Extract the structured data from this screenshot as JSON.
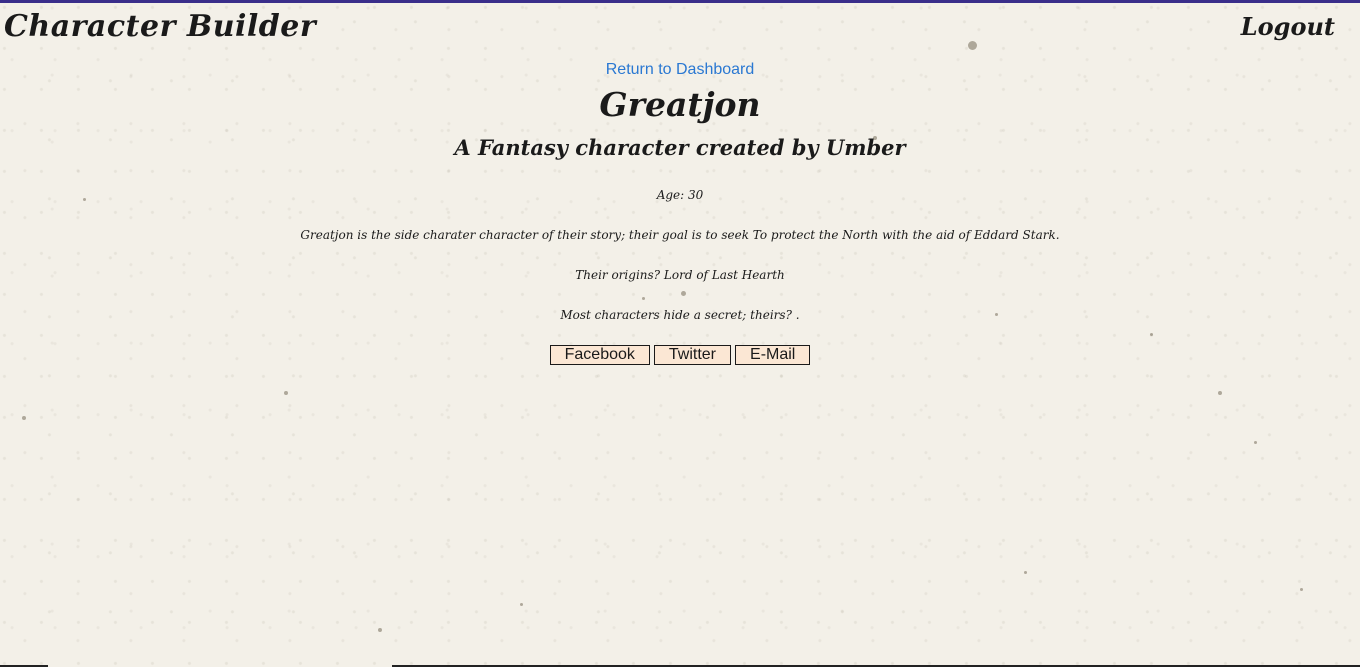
{
  "header": {
    "brand": "Character Builder",
    "logout_label": "Logout"
  },
  "main": {
    "return_link": "Return to Dashboard",
    "character_name": "Greatjon",
    "subtitle": "A Fantasy character created by Umber",
    "age": "Age: 30",
    "description": "Greatjon is the side charater character of their story; their goal is to seek To protect the North with the aid of Eddard Stark.",
    "origins": "Their origins? Lord of Last Hearth",
    "secret": "Most characters hide a secret; theirs? ."
  },
  "share": {
    "facebook": "Facebook",
    "twitter": "Twitter",
    "email": "E-Mail"
  },
  "colors": {
    "background": "#f3f0e8",
    "top_border": "#3a2e8a",
    "link": "#2a78d2",
    "share_button_bg": "#fbe7d4",
    "text": "#1a1a1a"
  }
}
